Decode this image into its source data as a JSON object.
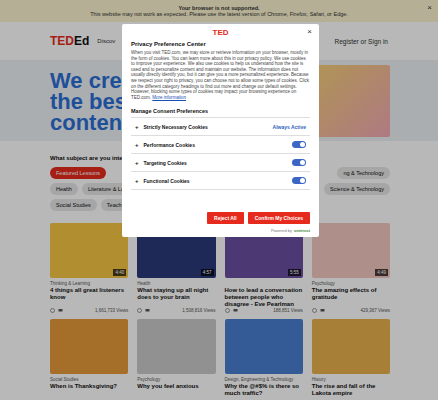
{
  "banner": {
    "title": "Your browser is not supported.",
    "message": "This website may not work as expected. Please use the latest version of Chrome, Firefox, Safari, or Edge.",
    "close": "×"
  },
  "header": {
    "logo": {
      "ted": "TED",
      "ed": "Ed"
    },
    "nav": "Discov",
    "account": "Register or Sign in"
  },
  "hero": {
    "lines": [
      "We crea",
      "the best",
      "content"
    ]
  },
  "subjects": {
    "prompt": "What subject are you interes",
    "rows": [
      {
        "left": [
          {
            "label": "Featured Lessons",
            "selected": true
          }
        ],
        "right": [
          {
            "label": "ng & Technology",
            "selected": false
          }
        ]
      },
      {
        "left": [
          {
            "label": "Health",
            "selected": false
          },
          {
            "label": "Literature & La",
            "selected": false
          }
        ],
        "right": [
          {
            "label": "Science & Technology",
            "selected": false
          }
        ]
      },
      {
        "left": [
          {
            "label": "Social Studies",
            "selected": false
          },
          {
            "label": "Teach",
            "selected": false
          }
        ],
        "right": []
      }
    ]
  },
  "cards": [
    {
      "category": "Thinking & Learning",
      "title": "4 things all great listeners know",
      "views": "1,661,733 Views",
      "duration": "4:40"
    },
    {
      "category": "Health",
      "title": "What staying up all night does to your brain",
      "views": "1,508,816 Views",
      "duration": "4:57"
    },
    {
      "category": "",
      "title": "How to lead a conversation between people who disagree - Eve Pearlman",
      "views": "188,851 Views",
      "duration": "5:55"
    },
    {
      "category": "Psychology",
      "title": "The amazing effects of gratitude",
      "views": "429,367 Views",
      "duration": "4:49"
    },
    {
      "category": "Social Studies",
      "title": "When is Thanksgiving?",
      "views": "",
      "duration": ""
    },
    {
      "category": "Psychology",
      "title": "Why you feel anxious",
      "views": "",
      "duration": ""
    },
    {
      "category": "Design, Engineering & Technology",
      "title": "Why the @#$% is there so much traffic?",
      "views": "",
      "duration": ""
    },
    {
      "category": "History",
      "title": "The rise and fall of the Lakota empire",
      "views": "",
      "duration": ""
    }
  ],
  "modal": {
    "logo": "TED",
    "close": "×",
    "title": "Privacy Preference Center",
    "body": "When you visit TED.com, we may store or retrieve information on your browser, mostly in the form of cookies. You can learn more about this in our privacy policy. We use cookies to improve your experience. We also use cookies to help us understand how the site is used and to personalize content and maintain our website. The information does not usually directly identify you, but it can give you a more personalized experience. Because we respect your right to privacy, you can choose not to allow some types of cookies. Click on the different category headings to find out more and change our default settings. However, blocking some types of cookies may impact your browsing experience on TED.com.",
    "link": "More information",
    "section": "Manage Consent Preferences",
    "categories": [
      {
        "expander": "+",
        "name": "Strictly Necessary Cookies",
        "kind": "always",
        "status": "Always Active",
        "on": true
      },
      {
        "expander": "+",
        "name": "Performance Cookies",
        "kind": "toggle",
        "status": "",
        "on": true
      },
      {
        "expander": "+",
        "name": "Targeting Cookies",
        "kind": "toggle",
        "status": "",
        "on": true
      },
      {
        "expander": "+",
        "name": "Functional Cookies",
        "kind": "toggle",
        "status": "",
        "on": true
      }
    ],
    "buttons": [
      {
        "label": "Reject All"
      },
      {
        "label": "Confirm My Choices"
      }
    ],
    "powered": {
      "prefix": "Powered by",
      "brand": "onetrust"
    }
  }
}
